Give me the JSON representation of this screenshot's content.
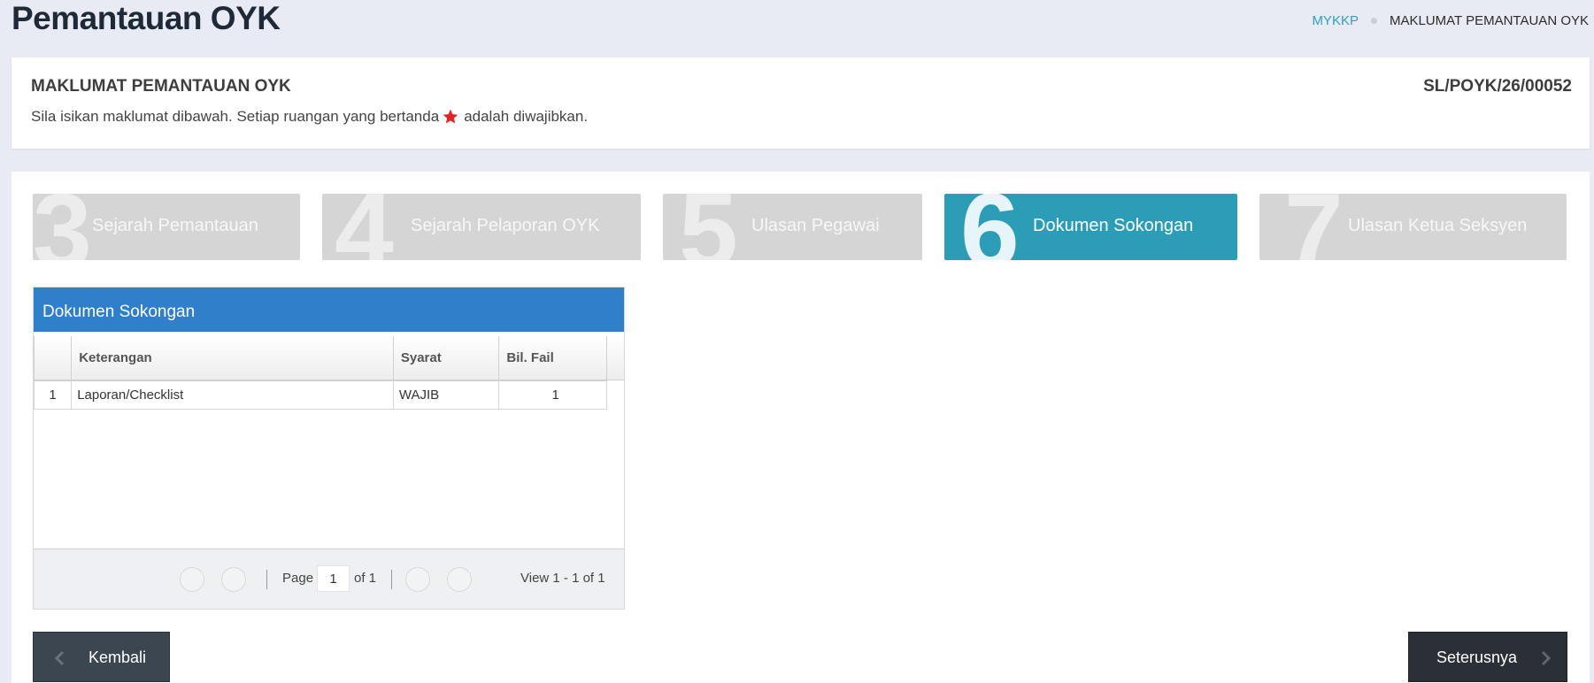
{
  "header": {
    "title": "Pemantauan OYK",
    "breadcrumb": [
      "MYKKP",
      "MAKLUMAT PEMANTAUAN OYK"
    ]
  },
  "info": {
    "title": "MAKLUMAT PEMANTAUAN OYK",
    "ref_no": "SL/POYK/26/00052",
    "instruction_before": "Sila isikan maklumat dibawah. Setiap ruangan yang bertanda",
    "instruction_after": "adalah diwajibkan.",
    "required_color": "#e32222"
  },
  "steps": [
    {
      "num": "3",
      "label": "Sejarah Pemantauan",
      "active": false
    },
    {
      "num": "4",
      "label": "Sejarah Pelaporan OYK",
      "active": false
    },
    {
      "num": "5",
      "label": "Ulasan Pegawai",
      "active": false
    },
    {
      "num": "6",
      "label": "Dokumen Sokongan",
      "active": true
    },
    {
      "num": "7",
      "label": "Ulasan Ketua Seksyen",
      "active": false
    }
  ],
  "grid": {
    "caption": "Dokumen Sokongan",
    "columns": [
      "",
      "Keterangan",
      "Syarat",
      "Bil. Fail"
    ],
    "rows": [
      {
        "no": "1",
        "keterangan": "Laporan/Checklist",
        "syarat": "WAJIB",
        "bil_fail": "1"
      }
    ],
    "pager": {
      "page_label": "Page",
      "page_value": "1",
      "of_label": "of 1",
      "view_text": "View 1 - 1 of 1"
    }
  },
  "buttons": {
    "back": "Kembali",
    "next": "Seterusnya"
  },
  "colors": {
    "accent": "#2c9db7",
    "grid_caption": "#2f7fcb",
    "link": "#2fa0c3"
  }
}
